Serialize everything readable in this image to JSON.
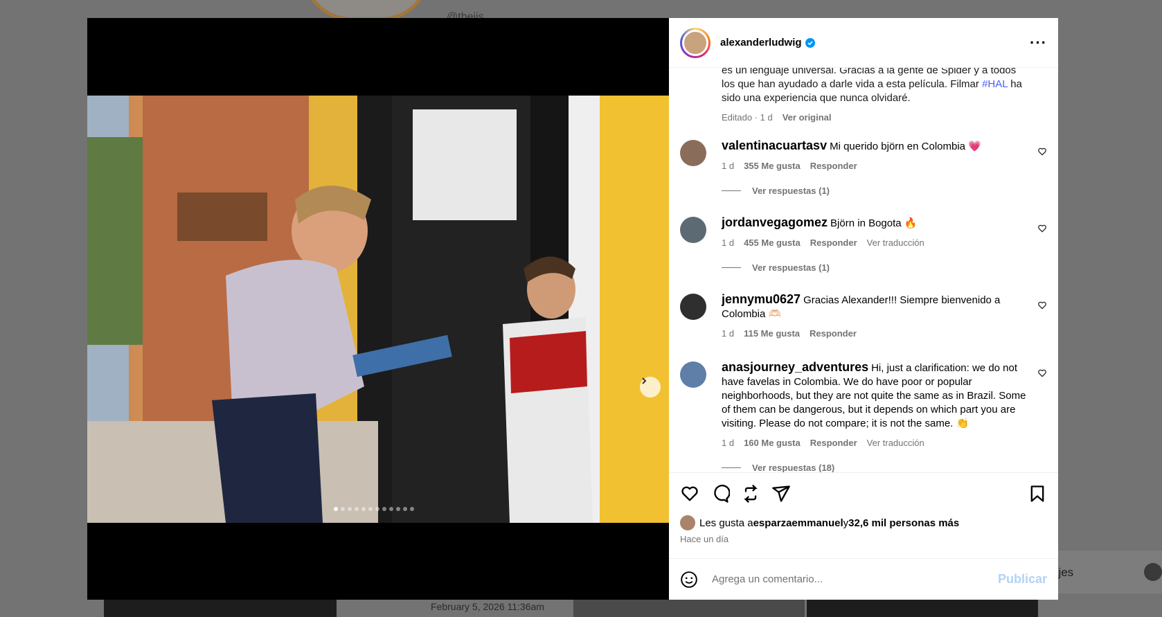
{
  "backdrop": {
    "handle": "@theiis",
    "date": "February 5, 2026 11:36am",
    "messages_label": "ajes"
  },
  "post": {
    "username": "alexanderludwig",
    "caption_lines": [
      "es un lenguaje universal. Gracias a la gente de Spider y a todos",
      "los que han ayudado a darle vida a esta película. Filmar ",
      " ha",
      "sido una experiencia que nunca olvidaré."
    ],
    "hashtag": "#HAL",
    "caption_edited": "Editado · 1 d",
    "caption_see_original": "Ver original",
    "dots_total": 12,
    "dots_active": 0
  },
  "comments": [
    {
      "user": "valentinacuartasv",
      "text": "Mi querido björn en Colombia 💗",
      "time": "1 d",
      "likes": "355 Me gusta",
      "reply": "Responder",
      "translate": "",
      "replies": "Ver respuestas (1)",
      "avatar_color": "#8a6c5a"
    },
    {
      "user": "jordanvegagomez",
      "text": "Björn in Bogota 🔥",
      "time": "1 d",
      "likes": "455 Me gusta",
      "reply": "Responder",
      "translate": "Ver traducción",
      "replies": "Ver respuestas (1)",
      "avatar_color": "#5b6a73"
    },
    {
      "user": "jennymu0627",
      "text": "Gracias Alexander!!! Siempre bienvenido a Colombia 🫶🏻",
      "time": "1 d",
      "likes": "115 Me gusta",
      "reply": "Responder",
      "translate": "",
      "replies": "",
      "avatar_color": "#2f2f2f"
    },
    {
      "user": "anasjourney_adventures",
      "text": "Hi, just a clarification: we do not have favelas in Colombia. We do have poor or popular neighborhoods, but they are not quite the same as in Brazil. Some of them can be dangerous, but it depends on which part you are visiting. Please do not compare; it is not the same. 👏",
      "time": "1 d",
      "likes": "160 Me gusta",
      "reply": "Responder",
      "translate": "Ver traducción",
      "replies": "Ver respuestas (18)",
      "avatar_color": "#5f7ea8"
    }
  ],
  "footer": {
    "likes_prefix": "Les gusta a ",
    "likes_user": "esparzaemmanuel",
    "likes_mid": " y ",
    "likes_count": "32,6 mil personas más",
    "time_ago": "Hace un día",
    "comment_placeholder": "Agrega un comentario...",
    "publish_label": "Publicar"
  },
  "icons": {
    "heart": "heart-icon",
    "comment": "comment-icon",
    "repost": "repost-icon",
    "share": "share-icon",
    "save": "bookmark-icon",
    "emoji": "emoji-icon",
    "next": "chevron-right-icon",
    "verified": "verified-badge-icon",
    "more": "more-options-icon"
  },
  "colors": {
    "link": "#4a5df9",
    "verified": "#0095f6",
    "publish": "#b2d3f6",
    "muted": "#737373"
  }
}
